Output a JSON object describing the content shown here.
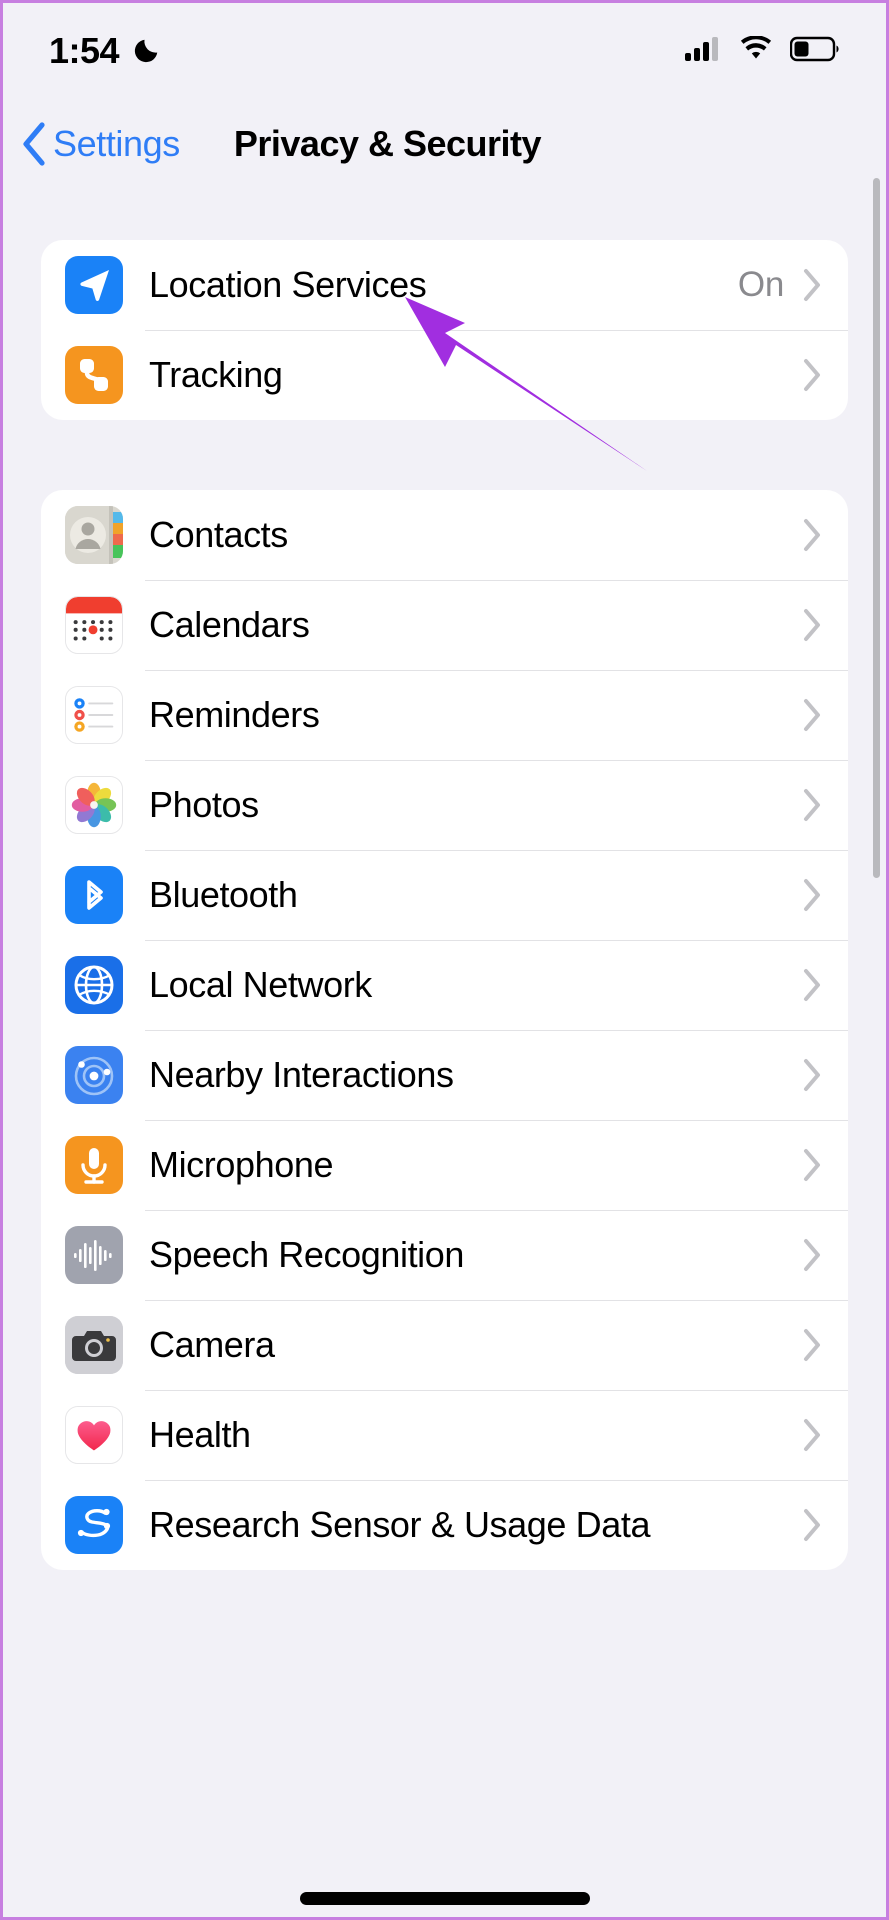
{
  "status_bar": {
    "time": "1:54",
    "dnd_icon": "moon-icon",
    "cellular_icon": "cellular-signal-icon",
    "wifi_icon": "wifi-icon",
    "battery_icon": "battery-icon"
  },
  "nav": {
    "back_label": "Settings",
    "back_icon": "chevron-left-icon",
    "title": "Privacy & Security"
  },
  "sections": [
    {
      "rows": [
        {
          "label": "Location Services",
          "value": "On",
          "icon": "location-arrow-icon"
        },
        {
          "label": "Tracking",
          "value": "",
          "icon": "tracking-icon"
        }
      ]
    },
    {
      "rows": [
        {
          "label": "Contacts",
          "value": "",
          "icon": "contacts-icon"
        },
        {
          "label": "Calendars",
          "value": "",
          "icon": "calendar-icon"
        },
        {
          "label": "Reminders",
          "value": "",
          "icon": "reminders-icon"
        },
        {
          "label": "Photos",
          "value": "",
          "icon": "photos-icon"
        },
        {
          "label": "Bluetooth",
          "value": "",
          "icon": "bluetooth-icon"
        },
        {
          "label": "Local Network",
          "value": "",
          "icon": "globe-icon"
        },
        {
          "label": "Nearby Interactions",
          "value": "",
          "icon": "nearby-interactions-icon"
        },
        {
          "label": "Microphone",
          "value": "",
          "icon": "microphone-icon"
        },
        {
          "label": "Speech Recognition",
          "value": "",
          "icon": "waveform-icon"
        },
        {
          "label": "Camera",
          "value": "",
          "icon": "camera-icon"
        },
        {
          "label": "Health",
          "value": "",
          "icon": "heart-icon"
        },
        {
          "label": "Research Sensor & Usage Data",
          "value": "",
          "icon": "research-sensor-icon"
        }
      ]
    }
  ],
  "annotation": {
    "type": "arrow",
    "color": "#a12ee0",
    "points_at": "Location Services"
  },
  "colors": {
    "page_background": "#f2f1f7",
    "card_background": "#ffffff",
    "accent_blue": "#2f7df6",
    "secondary_text": "#8a8a8e",
    "separator": "#e2e2e5",
    "frame_border": "#c77fe0"
  }
}
